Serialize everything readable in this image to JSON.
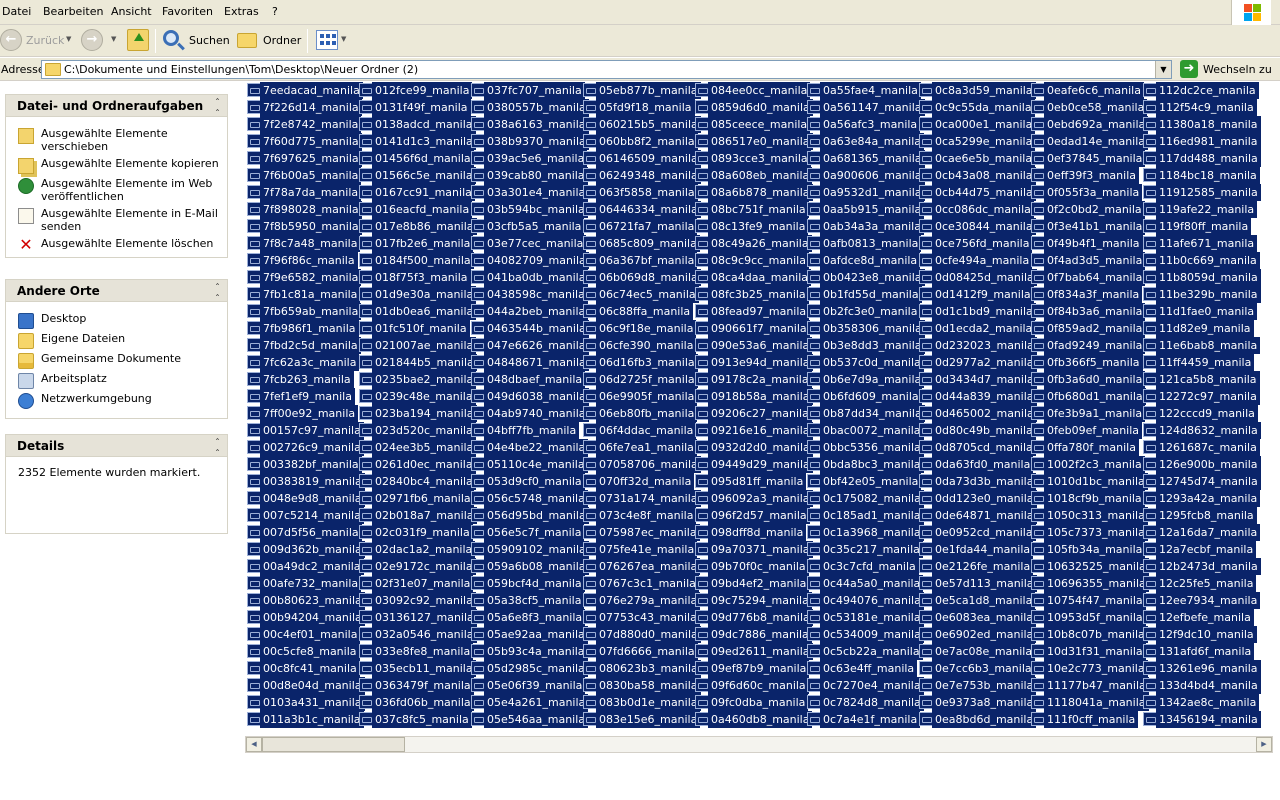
{
  "menu": [
    "Datei",
    "Bearbeiten",
    "Ansicht",
    "Favoriten",
    "Extras",
    "?"
  ],
  "toolbar": {
    "back_label": "Zurück",
    "search_label": "Suchen",
    "folders_label": "Ordner"
  },
  "address": {
    "label": "Adresse",
    "path": "C:\\Dokumente und Einstellungen\\Tom\\Desktop\\Neuer Ordner (2)",
    "go_label": "Wechseln zu"
  },
  "tasks_panel": {
    "title": "Datei- und Ordneraufgaben",
    "items": [
      "Ausgewählte Elemente verschieben",
      "Ausgewählte Elemente kopieren",
      "Ausgewählte Elemente im Web veröffentlichen",
      "Ausgewählte Elemente in E-Mail senden",
      "Ausgewählte Elemente löschen"
    ]
  },
  "places_panel": {
    "title": "Andere Orte",
    "items": [
      "Desktop",
      "Eigene Dateien",
      "Gemeinsame Dokumente",
      "Arbeitsplatz",
      "Netzwerkumgebung"
    ]
  },
  "details_panel": {
    "title": "Details",
    "text": "2352 Elemente wurden markiert."
  },
  "file_columns": [
    [
      "7eedacad_manila",
      "7f226d14_manila",
      "7f2e8742_manila",
      "7f60d775_manila",
      "7f697625_manila",
      "7f6b00a5_manila",
      "7f78a7da_manila",
      "7f898028_manila",
      "7f8b5950_manila",
      "7f8c7a48_manila",
      "7f96f86c_manila",
      "7f9e6582_manila",
      "7fb1c81a_manila",
      "7fb659ab_manila",
      "7fb986f1_manila",
      "7fbd2c5d_manila",
      "7fc62a3c_manila",
      "7fcb263_manila",
      "7fef1ef9_manila",
      "7ff00e92_manila",
      "00157c97_manila",
      "002726c9_manila",
      "003382bf_manila",
      "00383819_manila",
      "0048e9d8_manila",
      "007c5214_manila",
      "007d5f56_manila",
      "009d362b_manila",
      "00a49dc2_manila",
      "00afe732_manila",
      "00b80623_manila",
      "00b94204_manila",
      "00c4ef01_manila",
      "00c5cfe8_manila",
      "00c8fc41_manila",
      "00d8e04d_manila",
      "0103a431_manila",
      "011a3b1c_manila"
    ],
    [
      "012fce99_manila",
      "0131f49f_manila",
      "0138adcd_manila",
      "0141d1c3_manila",
      "01456f6d_manila",
      "01566c5e_manila",
      "0167cc91_manila",
      "016eacfd_manila",
      "017e8b86_manila",
      "017fb2e6_manila",
      "0184f500_manila",
      "018f75f3_manila",
      "01d9e30a_manila",
      "01db0ea6_manila",
      "01fc510f_manila",
      "021007ae_manila",
      "021844b5_manila",
      "0235bae2_manila",
      "0239c48e_manila",
      "023ba194_manila",
      "023d520c_manila",
      "024ee3b5_manila",
      "0261d0ec_manila",
      "02840bc4_manila",
      "02971fb6_manila",
      "02b018a7_manila",
      "02c031f9_manila",
      "02dac1a2_manila",
      "02e9172c_manila",
      "02f31e07_manila",
      "03092c92_manila",
      "03136127_manila",
      "032a0546_manila",
      "033e8fe8_manila",
      "035ecb11_manila",
      "0363479f_manila",
      "036fd06b_manila",
      "037c8fc5_manila"
    ],
    [
      "037fc707_manila",
      "0380557b_manila",
      "038a6163_manila",
      "038b9370_manila",
      "039ac5e6_manila",
      "039cab80_manila",
      "03a301e4_manila",
      "03b594bc_manila",
      "03cfb5a5_manila",
      "03e77cec_manila",
      "04082709_manila",
      "041ba0db_manila",
      "0438598c_manila",
      "044a2beb_manila",
      "0463544b_manila",
      "047e6626_manila",
      "04848671_manila",
      "048dbaef_manila",
      "049d6038_manila",
      "04ab9740_manila",
      "04bff7fb_manila",
      "04e4be22_manila",
      "05110c4e_manila",
      "053d9cf0_manila",
      "056c5748_manila",
      "056d95bd_manila",
      "056e5c7f_manila",
      "05909102_manila",
      "059a6b08_manila",
      "059bcf4d_manila",
      "05a38cf5_manila",
      "05a6e8f3_manila",
      "05ae92aa_manila",
      "05b93c4a_manila",
      "05d2985c_manila",
      "05e06f39_manila",
      "05e4a261_manila",
      "05e546aa_manila"
    ],
    [
      "05eb877b_manila",
      "05fd9f18_manila",
      "060215b5_manila",
      "060bb8f2_manila",
      "06146509_manila",
      "06249348_manila",
      "063f5858_manila",
      "06446334_manila",
      "06721fa7_manila",
      "0685c809_manila",
      "06a367bf_manila",
      "06b069d8_manila",
      "06c74ec5_manila",
      "06c88ffa_manila",
      "06c9f18e_manila",
      "06cfe390_manila",
      "06d16fb3_manila",
      "06d2725f_manila",
      "06e9905f_manila",
      "06eb80fb_manila",
      "06f4ddac_manila",
      "06fe7ea1_manila",
      "07058706_manila",
      "070ff32d_manila",
      "0731a174_manila",
      "073c4e8f_manila",
      "075987ec_manila",
      "075fe41e_manila",
      "076267ea_manila",
      "0767c3c1_manila",
      "076e279a_manila",
      "07753c43_manila",
      "07d880d0_manila",
      "07fd6666_manila",
      "080623b3_manila",
      "0830ba58_manila",
      "083b0d1e_manila",
      "083e15e6_manila"
    ],
    [
      "084ee0cc_manila",
      "0859d6d0_manila",
      "085ceece_manila",
      "086517e0_manila",
      "0893cce3_manila",
      "08a608eb_manila",
      "08a6b878_manila",
      "08bc751f_manila",
      "08c13fe9_manila",
      "08c49a26_manila",
      "08c9c9cc_manila",
      "08ca4daa_manila",
      "08fc3b25_manila",
      "08fead97_manila",
      "090661f7_manila",
      "090e53a6_manila",
      "0913e94d_manila",
      "09178c2a_manila",
      "0918b58a_manila",
      "09206c27_manila",
      "09216e16_manila",
      "0932d2d0_manila",
      "09449d29_manila",
      "095d81ff_manila",
      "096092a3_manila",
      "096f2d57_manila",
      "098dff8d_manila",
      "09a70371_manila",
      "09b70f0c_manila",
      "09bd4ef2_manila",
      "09c75294_manila",
      "09d776b8_manila",
      "09dc7886_manila",
      "09ed2611_manila",
      "09ef87b9_manila",
      "09f6d60c_manila",
      "09fc0dba_manila",
      "0a460db8_manila"
    ],
    [
      "0a55fae4_manila",
      "0a561147_manila",
      "0a56afc3_manila",
      "0a63e84a_manila",
      "0a681365_manila",
      "0a900606_manila",
      "0a9532d1_manila",
      "0aa5b915_manila",
      "0ab34a3a_manila",
      "0afb0813_manila",
      "0afdce8d_manila",
      "0b0423e8_manila",
      "0b1fd55d_manila",
      "0b2fc3e0_manila",
      "0b358306_manila",
      "0b3e8dd3_manila",
      "0b537c0d_manila",
      "0b6e7d9a_manila",
      "0b6fd609_manila",
      "0b87dd34_manila",
      "0bac0072_manila",
      "0bbc5356_manila",
      "0bda8bc3_manila",
      "0bf42e05_manila",
      "0c175082_manila",
      "0c185ad1_manila",
      "0c1a3968_manila",
      "0c35c217_manila",
      "0c3c7cfd_manila",
      "0c44a5a0_manila",
      "0c494076_manila",
      "0c53181e_manila",
      "0c534009_manila",
      "0c5cb22a_manila",
      "0c63e4ff_manila",
      "0c7270e4_manila",
      "0c7824d8_manila",
      "0c7a4e1f_manila"
    ],
    [
      "0c8a3d59_manila",
      "0c9c55da_manila",
      "0ca000e1_manila",
      "0ca5299e_manila",
      "0cae6e5b_manila",
      "0cb43a08_manila",
      "0cb44d75_manila",
      "0cc086dc_manila",
      "0ce30844_manila",
      "0ce756fd_manila",
      "0cfe494a_manila",
      "0d08425d_manila",
      "0d1412f9_manila",
      "0d1c1bd9_manila",
      "0d1ecda2_manila",
      "0d232023_manila",
      "0d2977a2_manila",
      "0d3434d7_manila",
      "0d44a839_manila",
      "0d465002_manila",
      "0d80c49b_manila",
      "0d8705cd_manila",
      "0da63fd0_manila",
      "0da73d3b_manila",
      "0dd123e0_manila",
      "0de64871_manila",
      "0e0952cd_manila",
      "0e1fda44_manila",
      "0e2126fe_manila",
      "0e57d113_manila",
      "0e5ca1d8_manila",
      "0e6083ea_manila",
      "0e6902ed_manila",
      "0e7ac08e_manila",
      "0e7cc6b3_manila",
      "0e7e753b_manila",
      "0e9373a8_manila",
      "0ea8bd6d_manila"
    ],
    [
      "0eafe6c6_manila",
      "0eb0ce58_manila",
      "0ebd692a_manila",
      "0edad14e_manila",
      "0ef37845_manila",
      "0eff39f3_manila",
      "0f055f3a_manila",
      "0f2c0bd2_manila",
      "0f3e41b1_manila",
      "0f49b4f1_manila",
      "0f4ad3d5_manila",
      "0f7bab64_manila",
      "0f834a3f_manila",
      "0f84b3a6_manila",
      "0f859ad2_manila",
      "0fad9249_manila",
      "0fb366f5_manila",
      "0fb3a6d0_manila",
      "0fb680d1_manila",
      "0fe3b9a1_manila",
      "0feb09ef_manila",
      "0ffa780f_manila",
      "1002f2c3_manila",
      "1010d1bc_manila",
      "1018cf9b_manila",
      "1050c313_manila",
      "105c7373_manila",
      "105fb34a_manila",
      "10632525_manila",
      "10696355_manila",
      "10754f47_manila",
      "10953d5f_manila",
      "10b8c07b_manila",
      "10d31f31_manila",
      "10e2c773_manila",
      "11177b47_manila",
      "1118041a_manila",
      "111f0cff_manila"
    ],
    [
      "112dc2ce_manila",
      "112f54c9_manila",
      "11380a18_manila",
      "116ed981_manila",
      "117dd488_manila",
      "1184bc18_manila",
      "11912585_manila",
      "119afe22_manila",
      "119f80ff_manila",
      "11afe671_manila",
      "11b0c669_manila",
      "11b8059d_manila",
      "11be329b_manila",
      "11d1fae0_manila",
      "11d82e9_manila",
      "11e6bab8_manila",
      "11ff4459_manila",
      "121ca5b8_manila",
      "12272c97_manila",
      "122cccd9_manila",
      "124d8632_manila",
      "1261687c_manila",
      "126e900b_manila",
      "12745d74_manila",
      "1293a42a_manila",
      "1295fcb8_manila",
      "12a16da7_manila",
      "12a7ecbf_manila",
      "12b2473d_manila",
      "12c25fe5_manila",
      "12ee7934_manila",
      "12efbefe_manila",
      "12f9dc10_manila",
      "131afd6f_manila",
      "13261e96_manila",
      "133d4bd4_manila",
      "1342ae8c_manila",
      "13456194_manila"
    ]
  ]
}
